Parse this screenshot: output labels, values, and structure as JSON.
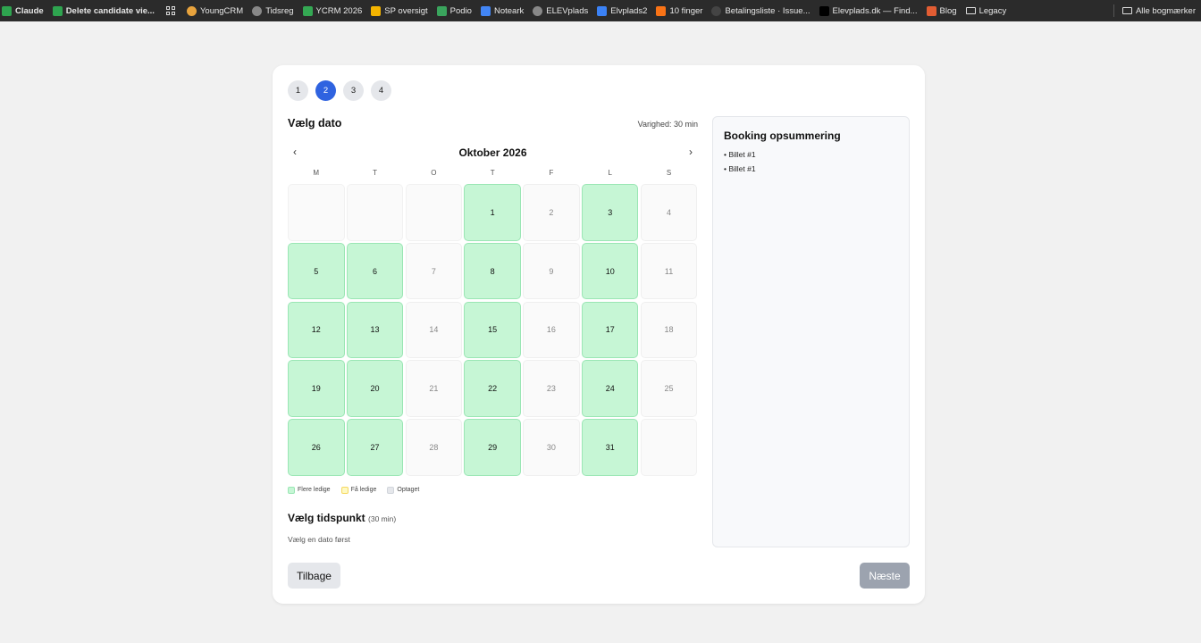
{
  "bookmarks": {
    "items": [
      {
        "label": "Claude",
        "icon": "claude-icon",
        "color": "#2ea44f",
        "pinned": true
      },
      {
        "label": "Delete candidate vie...",
        "icon": "checkbox-icon",
        "color": "#2ea44f",
        "pinned": true
      },
      {
        "label": "YoungCRM",
        "icon": "youngcrm-icon",
        "color": "#e8a33d"
      },
      {
        "label": "Tidsreg",
        "icon": "globe-icon",
        "color": "#888888"
      },
      {
        "label": "YCRM 2026",
        "icon": "drive-icon",
        "color": "#34a853"
      },
      {
        "label": "SP oversigt",
        "icon": "chart-icon",
        "color": "#f4b400"
      },
      {
        "label": "Podio",
        "icon": "podio-icon",
        "color": "#3aa55d"
      },
      {
        "label": "Noteark",
        "icon": "doc-icon",
        "color": "#4285f4"
      },
      {
        "label": "ELEVplads",
        "icon": "globe-icon",
        "color": "#888888"
      },
      {
        "label": "Elvplads2",
        "icon": "e-icon",
        "color": "#3b82f6"
      },
      {
        "label": "10 finger",
        "icon": "fire-icon",
        "color": "#f97316"
      },
      {
        "label": "Betalingsliste · Issue...",
        "icon": "github-icon",
        "color": "#444444"
      },
      {
        "label": "Elevplads.dk — Find...",
        "icon": "triangle-icon",
        "color": "#000000"
      },
      {
        "label": "Blog",
        "icon": "sun-icon",
        "color": "#e25d33"
      },
      {
        "label": "Legacy",
        "icon": "folder-icon",
        "color": "#dddddd"
      }
    ],
    "all_bookmarks": "Alle bogmærker"
  },
  "steps": [
    "1",
    "2",
    "3",
    "4"
  ],
  "active_step": 2,
  "date_section": {
    "title": "Vælg dato",
    "duration": "Varighed: 30 min",
    "month": "Oktober 2026",
    "prev": "‹",
    "next": "›",
    "weekdays": [
      "M",
      "T",
      "O",
      "T",
      "F",
      "L",
      "S"
    ]
  },
  "calendar": {
    "leading_empty": 3,
    "available": [
      1,
      3,
      5,
      6,
      8,
      10,
      12,
      13,
      15,
      17,
      19,
      20,
      22,
      24,
      26,
      27,
      29,
      31
    ],
    "days_in_month": 31,
    "trailing_empty": 1
  },
  "legend": {
    "many": "Flere ledige",
    "few": "Få ledige",
    "booked": "Optaget"
  },
  "time_section": {
    "title": "Vælg tidspunkt",
    "subtitle": "(30 min)",
    "hint": "Vælg en dato først"
  },
  "summary": {
    "title": "Booking opsummering",
    "items": [
      "• Billet #1",
      "• Billet #1"
    ]
  },
  "buttons": {
    "back": "Tilbage",
    "next": "Næste"
  },
  "colors": {
    "accent": "#2f63e0",
    "available": "#c6f6d5",
    "few": "#fef9c3",
    "booked": "#e5e7eb"
  }
}
